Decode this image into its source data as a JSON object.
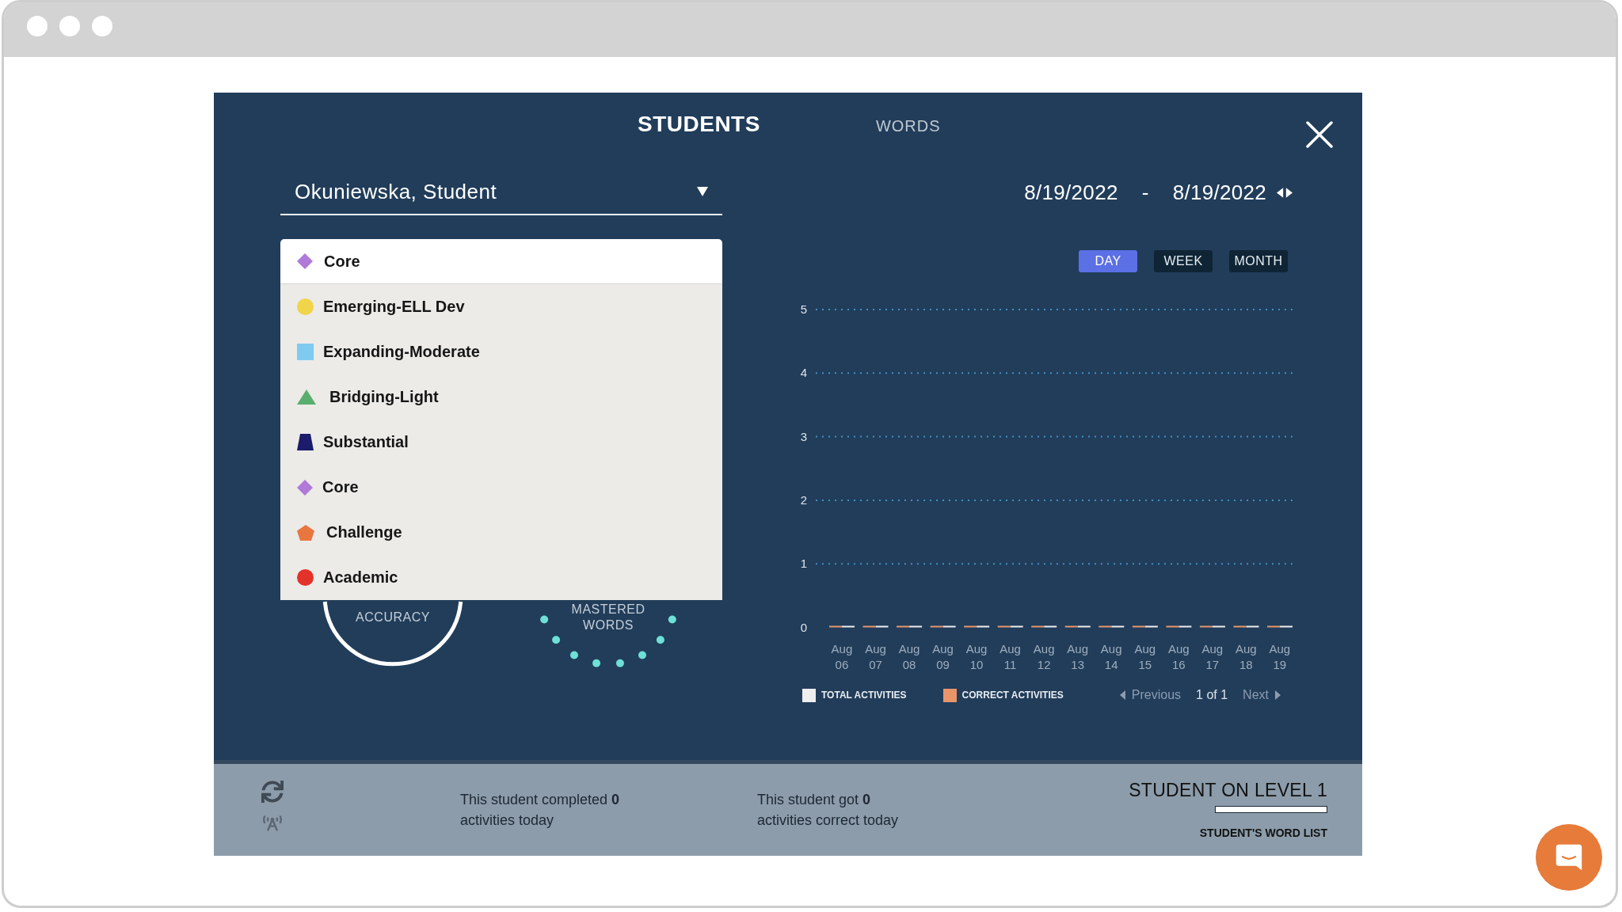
{
  "tabs": [
    {
      "label": "STUDENTS",
      "selected": true
    },
    {
      "label": "WORDS",
      "selected": false
    }
  ],
  "student_select": {
    "value": "Okuniewska, Student"
  },
  "date_range": {
    "start": "8/19/2022",
    "separator": "-",
    "end": "8/19/2022"
  },
  "level_select": {
    "expanded": true,
    "value": {
      "label": "Core",
      "kind": "diamond",
      "color": "#b07ad8"
    },
    "options": [
      {
        "label": "Emerging-ELL Dev",
        "kind": "circle",
        "color": "#f0d54a"
      },
      {
        "label": "Expanding-Moderate",
        "kind": "square",
        "color": "#7fcbf0"
      },
      {
        "label": "Bridging-Light",
        "kind": "triangle",
        "color": "#5aae6e"
      },
      {
        "label": "Substantial",
        "kind": "trapezoid",
        "color": "#1b1c6b"
      },
      {
        "label": "Core",
        "kind": "diamond",
        "color": "#b07ad8"
      },
      {
        "label": "Challenge",
        "kind": "pentagon",
        "color": "#e8773f"
      },
      {
        "label": "Academic",
        "kind": "circle",
        "color": "#e3322a"
      }
    ]
  },
  "gauges": [
    {
      "kind": "ring",
      "label": "ACCURACY"
    },
    {
      "kind": "dots",
      "label": "MASTERED WORDS"
    }
  ],
  "period_buttons": [
    {
      "label": "DAY",
      "selected": true
    },
    {
      "label": "WEEK",
      "selected": false
    },
    {
      "label": "MONTH",
      "selected": false
    }
  ],
  "chart": {
    "chart_data": {
      "type": "bar",
      "categories": [
        "Aug 06",
        "Aug 07",
        "Aug 08",
        "Aug 09",
        "Aug 10",
        "Aug 11",
        "Aug 12",
        "Aug 13",
        "Aug 14",
        "Aug 15",
        "Aug 16",
        "Aug 17",
        "Aug 18",
        "Aug 19"
      ],
      "series": [
        {
          "name": "TOTAL ACTIVITIES",
          "color": "#eeeeee",
          "values": [
            0,
            0,
            0,
            0,
            0,
            0,
            0,
            0,
            0,
            0,
            0,
            0,
            0,
            0
          ]
        },
        {
          "name": "CORRECT ACTIVITIES",
          "color": "#e8956a",
          "values": [
            0,
            0,
            0,
            0,
            0,
            0,
            0,
            0,
            0,
            0,
            0,
            0,
            0,
            0
          ]
        }
      ],
      "ylim": [
        0,
        5
      ],
      "yticks": [
        0,
        1,
        2,
        3,
        4,
        5
      ],
      "grid": true,
      "legend": "bottom"
    },
    "pager": {
      "previous": "Previous",
      "page": "1 of 1",
      "next": "Next"
    }
  },
  "summary": [
    "This student completed **0**\nactivities today",
    "This student got **0**\nactivities correct today"
  ],
  "level_status": {
    "title": "STUDENT ON LEVEL 1",
    "progress": {
      "level": 0
    },
    "link": "STUDENT'S WORD LIST"
  }
}
